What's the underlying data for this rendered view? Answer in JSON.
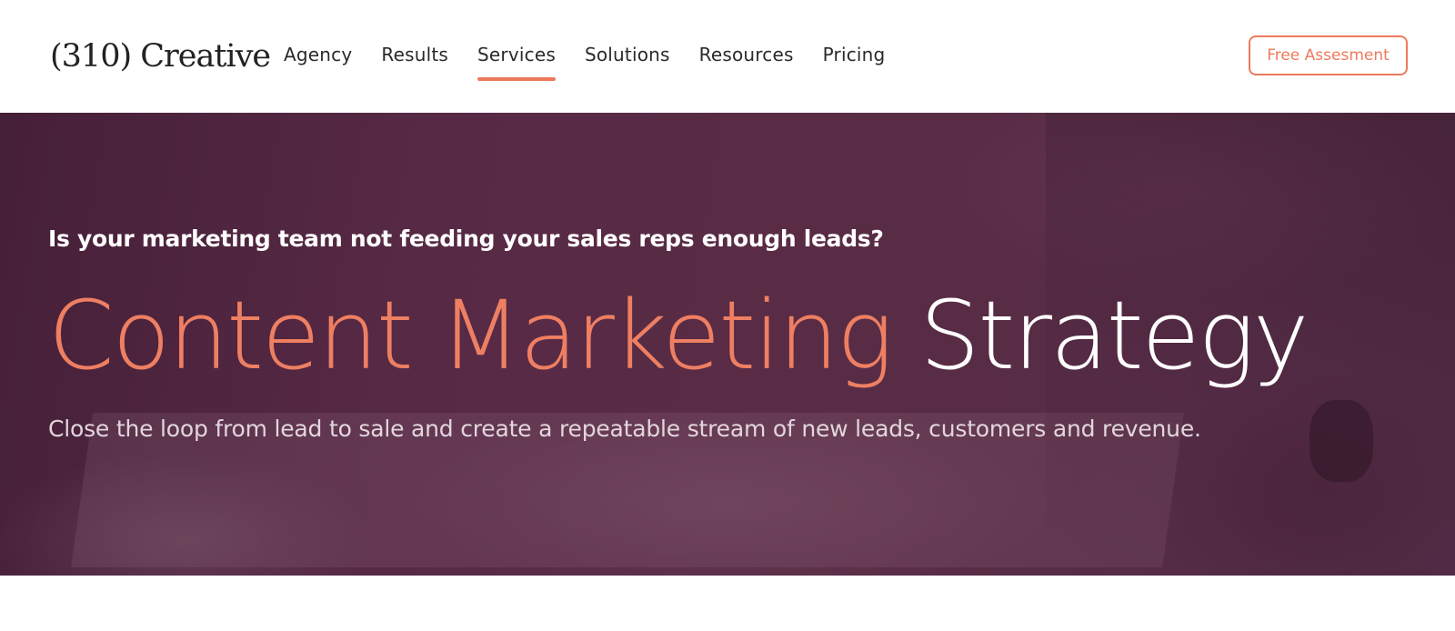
{
  "header": {
    "logo_text": "(310) Creative",
    "nav": [
      {
        "label": "Agency"
      },
      {
        "label": "Results"
      },
      {
        "label": "Services",
        "active": true
      },
      {
        "label": "Solutions"
      },
      {
        "label": "Resources"
      },
      {
        "label": "Pricing"
      }
    ],
    "cta_label": "Free Assesment"
  },
  "hero": {
    "eyebrow": "Is your marketing team not feeding your sales reps enough leads?",
    "headline_accent": "Content Marketing",
    "headline_rest": "Strategy",
    "subtitle": "Close the loop from lead to sale and create a repeatable stream of new leads, customers and revenue."
  },
  "colors": {
    "accent": "#ee7a5b",
    "hero_tint": "#5a2c47",
    "text_dark": "#2a2a2a"
  }
}
